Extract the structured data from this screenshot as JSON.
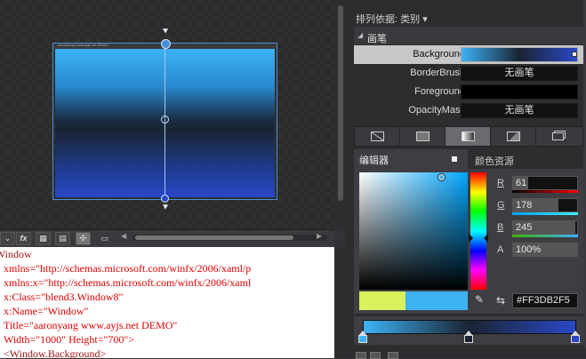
{
  "artboard": {
    "window_title_text": "aaronyang www.ayjs.net DEMO"
  },
  "toolbar": {
    "fx_label": "fx"
  },
  "code": {
    "lines": [
      "<Window",
      "xmlns=\"http://schemas.microsoft.com/winfx/2006/xaml/p",
      "xmlns:x=\"http://schemas.microsoft.com/winfx/2006/xaml",
      "x:Class=\"blend3.Window8\"",
      "x:Name=\"Window\"",
      "Title=\"aaronyang www.ayjs.net DEMO\"",
      "Width=\"1000\" Height=\"700\">",
      "<Window.Background>"
    ]
  },
  "properties": {
    "sort_label": "排列依据: 类别",
    "category_label": "画笔",
    "rows": [
      {
        "name": "Background",
        "value": ""
      },
      {
        "name": "BorderBrush",
        "value": "无画笔"
      },
      {
        "name": "Foreground",
        "value": ""
      },
      {
        "name": "OpacityMask",
        "value": "无画笔"
      }
    ]
  },
  "editor": {
    "tab_editor": "编辑器",
    "tab_resources": "颜色资源",
    "channels": {
      "r_label": "R",
      "r_value": "61",
      "g_label": "G",
      "g_value": "178",
      "b_label": "B",
      "b_value": "245",
      "a_label": "A",
      "a_value": "100%"
    },
    "hex_value": "#FF3DB2F5"
  },
  "colors": {
    "selected_color": "#3db2f5",
    "previous_color": "#d7f25c",
    "gradient_stops": [
      "#3db2f5",
      "#1a2432",
      "#2a48c8"
    ],
    "selection_outline": "#4a90d9"
  },
  "icons": {
    "fx": "fx-icon",
    "grid1": "grid-icon",
    "grid2": "grid-alt-icon",
    "snap": "snap-icon",
    "comment": "comment-icon",
    "eyedropper": "eyedropper-icon",
    "swap": "swap-icon"
  }
}
